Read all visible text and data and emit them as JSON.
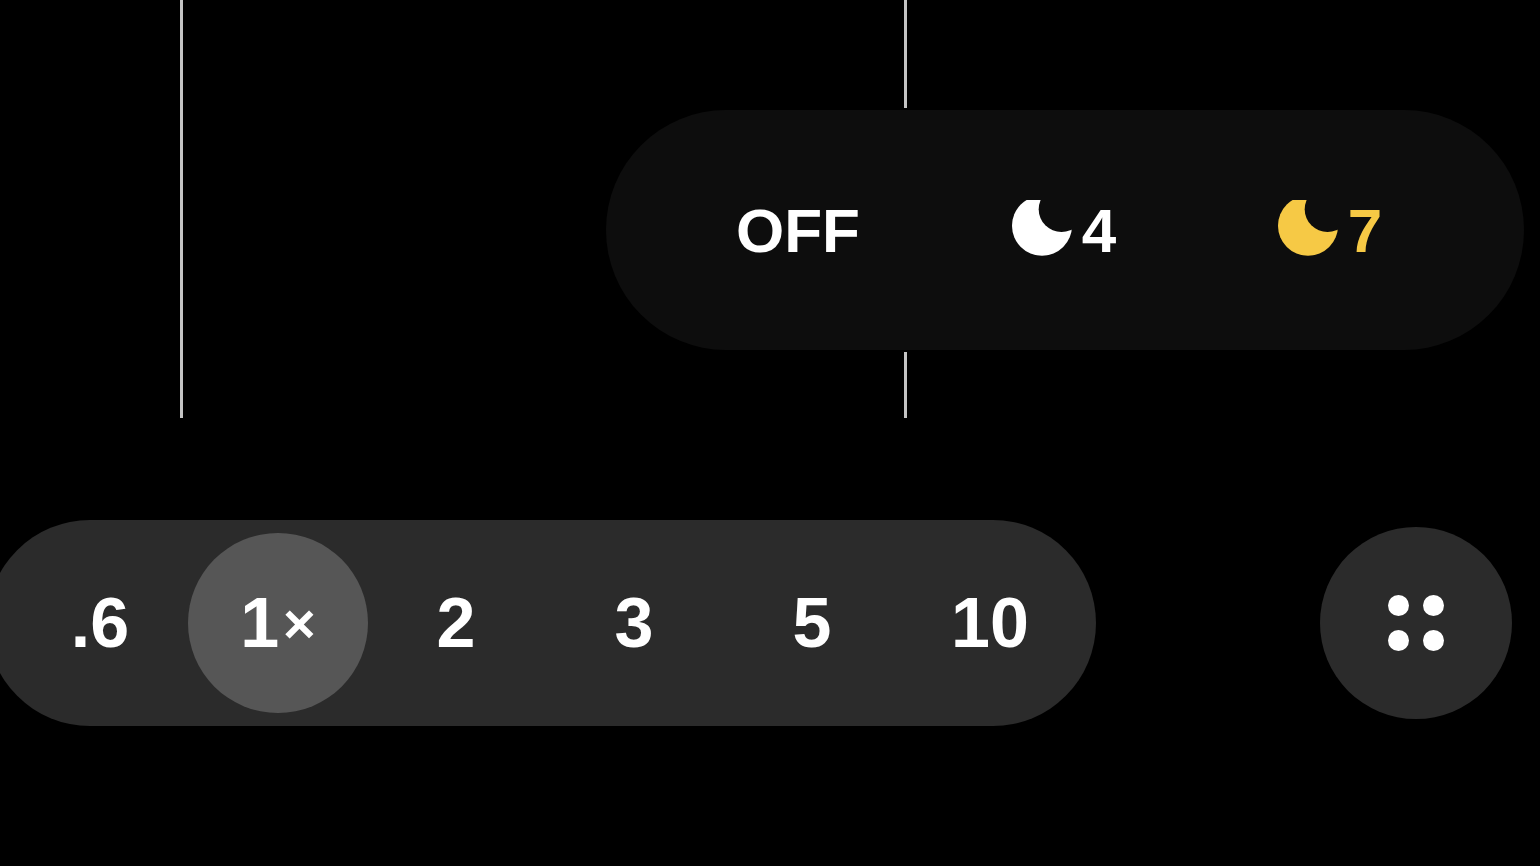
{
  "night_mode": {
    "options": [
      {
        "kind": "text",
        "label": "OFF",
        "selected": false
      },
      {
        "kind": "moon",
        "label": "4",
        "selected": false
      },
      {
        "kind": "moon",
        "label": "7",
        "selected": true
      }
    ]
  },
  "zoom": {
    "levels": [
      {
        "label": ".6",
        "selected": false
      },
      {
        "label": "1",
        "unit": "×",
        "selected": true
      },
      {
        "label": "2",
        "selected": false
      },
      {
        "label": "3",
        "selected": false
      },
      {
        "label": "5",
        "selected": false
      },
      {
        "label": "10",
        "selected": false
      }
    ]
  }
}
